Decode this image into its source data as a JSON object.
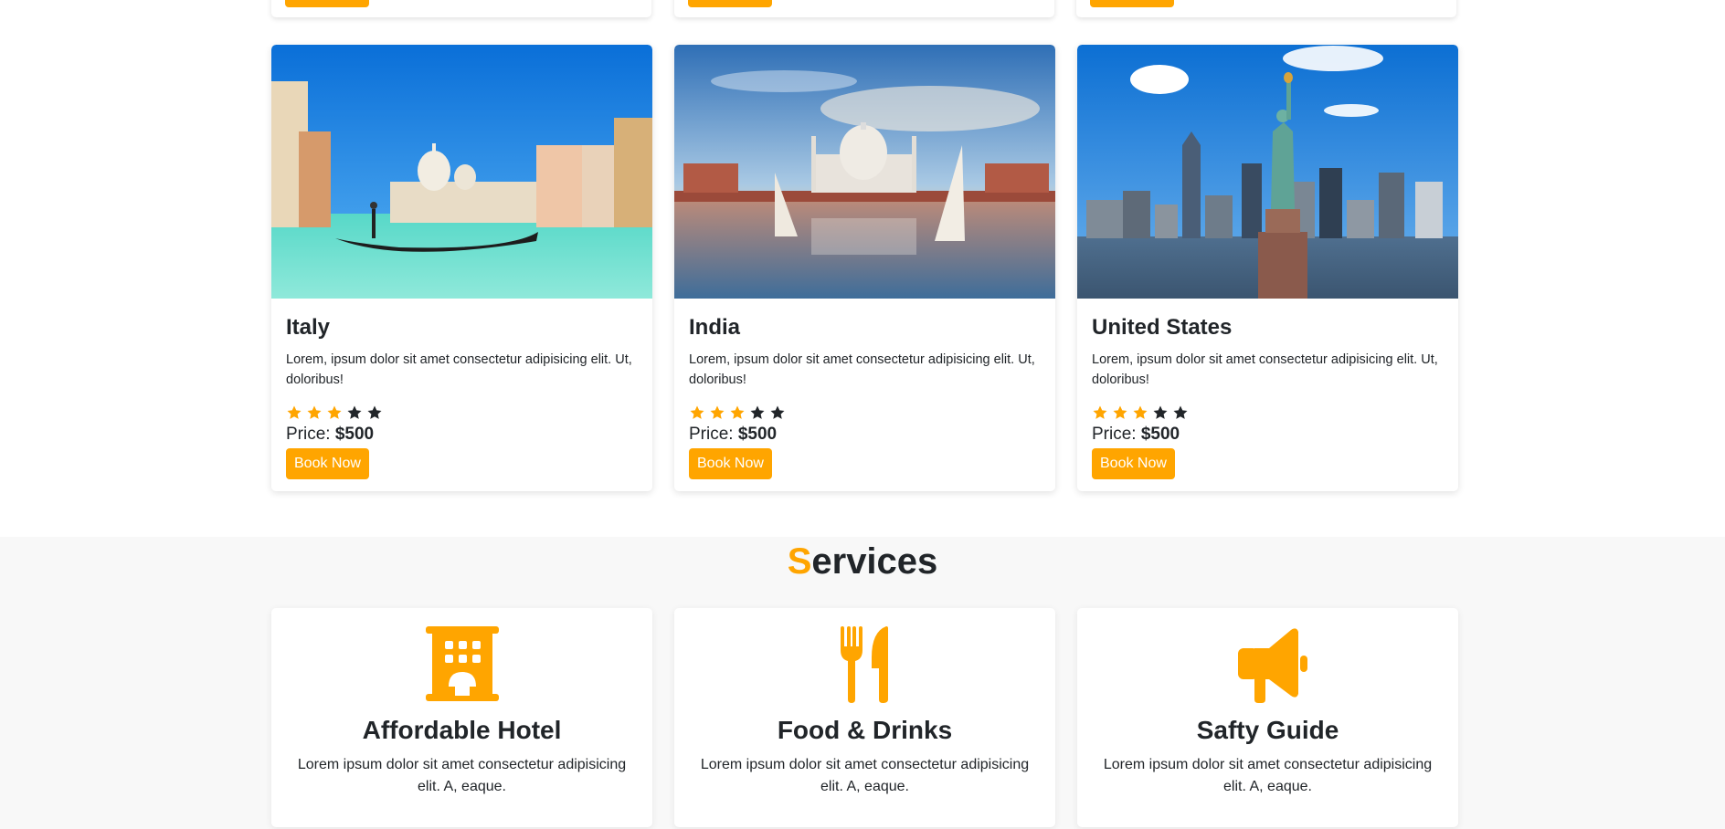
{
  "colors": {
    "accent": "#ffa500",
    "dark": "#212529",
    "services_bg": "#f8f8f8"
  },
  "destinations": [
    {
      "title": "Italy",
      "description": "Lorem, ipsum dolor sit amet consectetur adipisicing elit. Ut, doloribus!",
      "rating": 3,
      "max_rating": 5,
      "price_label": "Price:",
      "price_value": "$500",
      "button_label": "Book Now",
      "image": "venice-canal-gondola-photo"
    },
    {
      "title": "India",
      "description": "Lorem, ipsum dolor sit amet consectetur adipisicing elit. Ut, doloribus!",
      "rating": 3,
      "max_rating": 5,
      "price_label": "Price:",
      "price_value": "$500",
      "button_label": "Book Now",
      "image": "taj-mahal-sunset-photo"
    },
    {
      "title": "United States",
      "description": "Lorem, ipsum dolor sit amet consectetur adipisicing elit. Ut, doloribus!",
      "rating": 3,
      "max_rating": 5,
      "price_label": "Price:",
      "price_value": "$500",
      "button_label": "Book Now",
      "image": "statue-of-liberty-skyline-photo"
    }
  ],
  "services": {
    "title_first_letter": "S",
    "title_rest": "ervices",
    "items": [
      {
        "icon": "hotel-icon",
        "title": "Affordable Hotel",
        "description": "Lorem ipsum dolor sit amet consectetur adipisicing elit. A, eaque."
      },
      {
        "icon": "utensils-icon",
        "title": "Food & Drinks",
        "description": "Lorem ipsum dolor sit amet consectetur adipisicing elit. A, eaque."
      },
      {
        "icon": "bullhorn-icon",
        "title": "Safty Guide",
        "description": "Lorem ipsum dolor sit amet consectetur adipisicing elit. A, eaque."
      }
    ]
  }
}
